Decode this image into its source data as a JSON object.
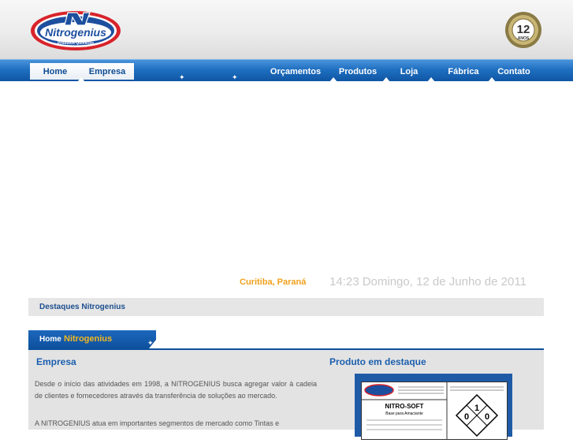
{
  "header": {
    "logo_text": "Nitrogenius",
    "logo_subtext": "Produtos Químicos",
    "badge_number": "12",
    "badge_label": "ANOS"
  },
  "nav": {
    "tabs_left": [
      "Home",
      "Empresa"
    ],
    "items_right": [
      "Orçamentos",
      "Produtos",
      "Loja",
      "Fábrica",
      "Contato"
    ]
  },
  "info": {
    "location": "Curitiba, Paraná",
    "datetime": "14:23 Domingo, 12 de Junho de 2011"
  },
  "highlights": {
    "label": "Destaques Nitrogenius"
  },
  "section_tab": {
    "prefix": "Home",
    "brand": "Nitrogenius"
  },
  "empresa": {
    "title": "Empresa",
    "paragraph1": "Desde o início das atividades em 1998, a NITROGENIUS busca agregar valor à cadeia de clientes e fornecedores através da transferência de soluções ao mercado.",
    "paragraph2": "A NITROGENIUS atua em importantes segmentos de mercado como Tintas e"
  },
  "produto": {
    "title": "Produto em destaque",
    "label_title": "NITRO-SOFT",
    "label_subtitle": "Base para Amaciante",
    "hazard_top": "1",
    "hazard_left": "0",
    "hazard_right": "0"
  },
  "colors": {
    "nav_blue": "#1f6fc1",
    "accent_orange": "#f0a01c",
    "title_blue": "#1c5fae",
    "logo_red": "#d8232a"
  }
}
